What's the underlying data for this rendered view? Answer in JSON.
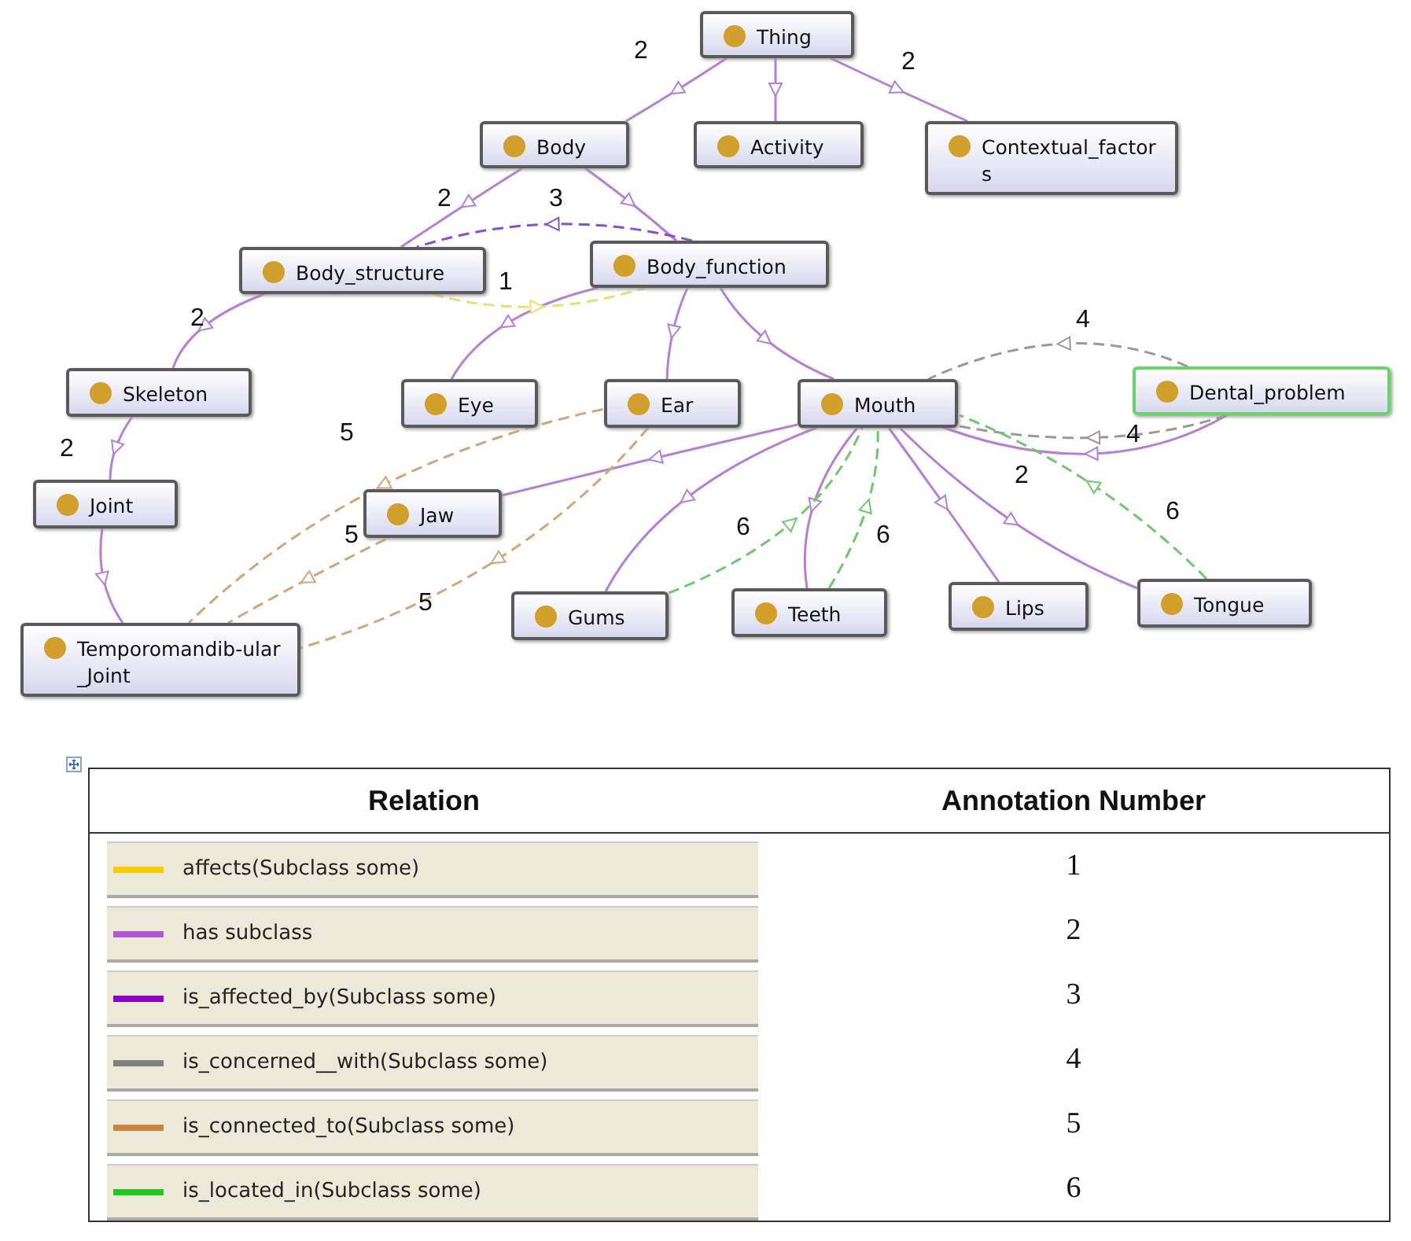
{
  "graph": {
    "nodes": [
      {
        "label": "Thing",
        "selected": false
      },
      {
        "label": "Body",
        "selected": false
      },
      {
        "label": "Activity",
        "selected": false
      },
      {
        "label": "Contextual_factors",
        "selected": false
      },
      {
        "label": "Body_structure",
        "selected": false
      },
      {
        "label": "Body_function",
        "selected": false
      },
      {
        "label": "Skeleton",
        "selected": false
      },
      {
        "label": "Eye",
        "selected": false
      },
      {
        "label": "Ear",
        "selected": false
      },
      {
        "label": "Mouth",
        "selected": false
      },
      {
        "label": "Dental_problem",
        "selected": true
      },
      {
        "label": "Joint",
        "selected": false
      },
      {
        "label": "Jaw",
        "selected": false
      },
      {
        "label": "Temporomandib-ular_Joint",
        "selected": false
      },
      {
        "label": "Gums",
        "selected": false
      },
      {
        "label": "Teeth",
        "selected": false
      },
      {
        "label": "Lips",
        "selected": false
      },
      {
        "label": "Tongue",
        "selected": false
      }
    ],
    "edge_labels": [
      "2",
      "2",
      "2",
      "3",
      "1",
      "2",
      "4",
      "5",
      "2",
      "4",
      "2",
      "6",
      "5",
      "6",
      "6",
      "5"
    ]
  },
  "table": {
    "columns": [
      "Relation",
      "Annotation Number"
    ],
    "rows": [
      {
        "relation": "affects(Subclass some)",
        "color": "#f5cf00",
        "number": "1"
      },
      {
        "relation": "has subclass",
        "color": "#b455d6",
        "number": "2"
      },
      {
        "relation": "is_affected_by(Subclass some)",
        "color": "#8b00c9",
        "number": "3"
      },
      {
        "relation": "is_concerned__with(Subclass some)",
        "color": "#808080",
        "number": "4"
      },
      {
        "relation": "is_connected_to(Subclass some)",
        "color": "#c8853f",
        "number": "5"
      },
      {
        "relation": "is_located_in(Subclass some)",
        "color": "#22c822",
        "number": "6"
      }
    ]
  }
}
